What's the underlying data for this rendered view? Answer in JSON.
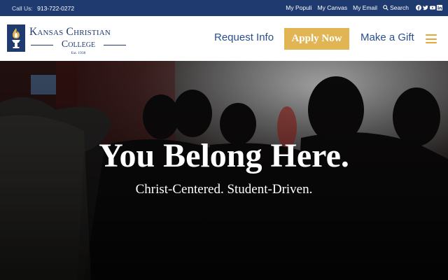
{
  "topbar": {
    "call_label": "Call Us:",
    "phone": "913-722-0272",
    "links": [
      "My Populi",
      "My Canvas",
      "My Email"
    ],
    "search_label": "Search",
    "socials": [
      "facebook-icon",
      "twitter-icon",
      "youtube-icon",
      "linkedin-icon"
    ]
  },
  "logo": {
    "line1": "Kansas Christian",
    "line2": "College",
    "est": "Est. 1938"
  },
  "nav": {
    "request_info": "Request Info",
    "apply_now": "Apply Now",
    "make_gift": "Make a Gift"
  },
  "hero": {
    "title": "You Belong Here.",
    "subtitle": "Christ-Centered. Student-Driven."
  },
  "colors": {
    "navy": "#1e3a6e",
    "link_blue": "#2b4f8e",
    "gold": "#e2b554",
    "hamburger": "#e2a93a"
  }
}
